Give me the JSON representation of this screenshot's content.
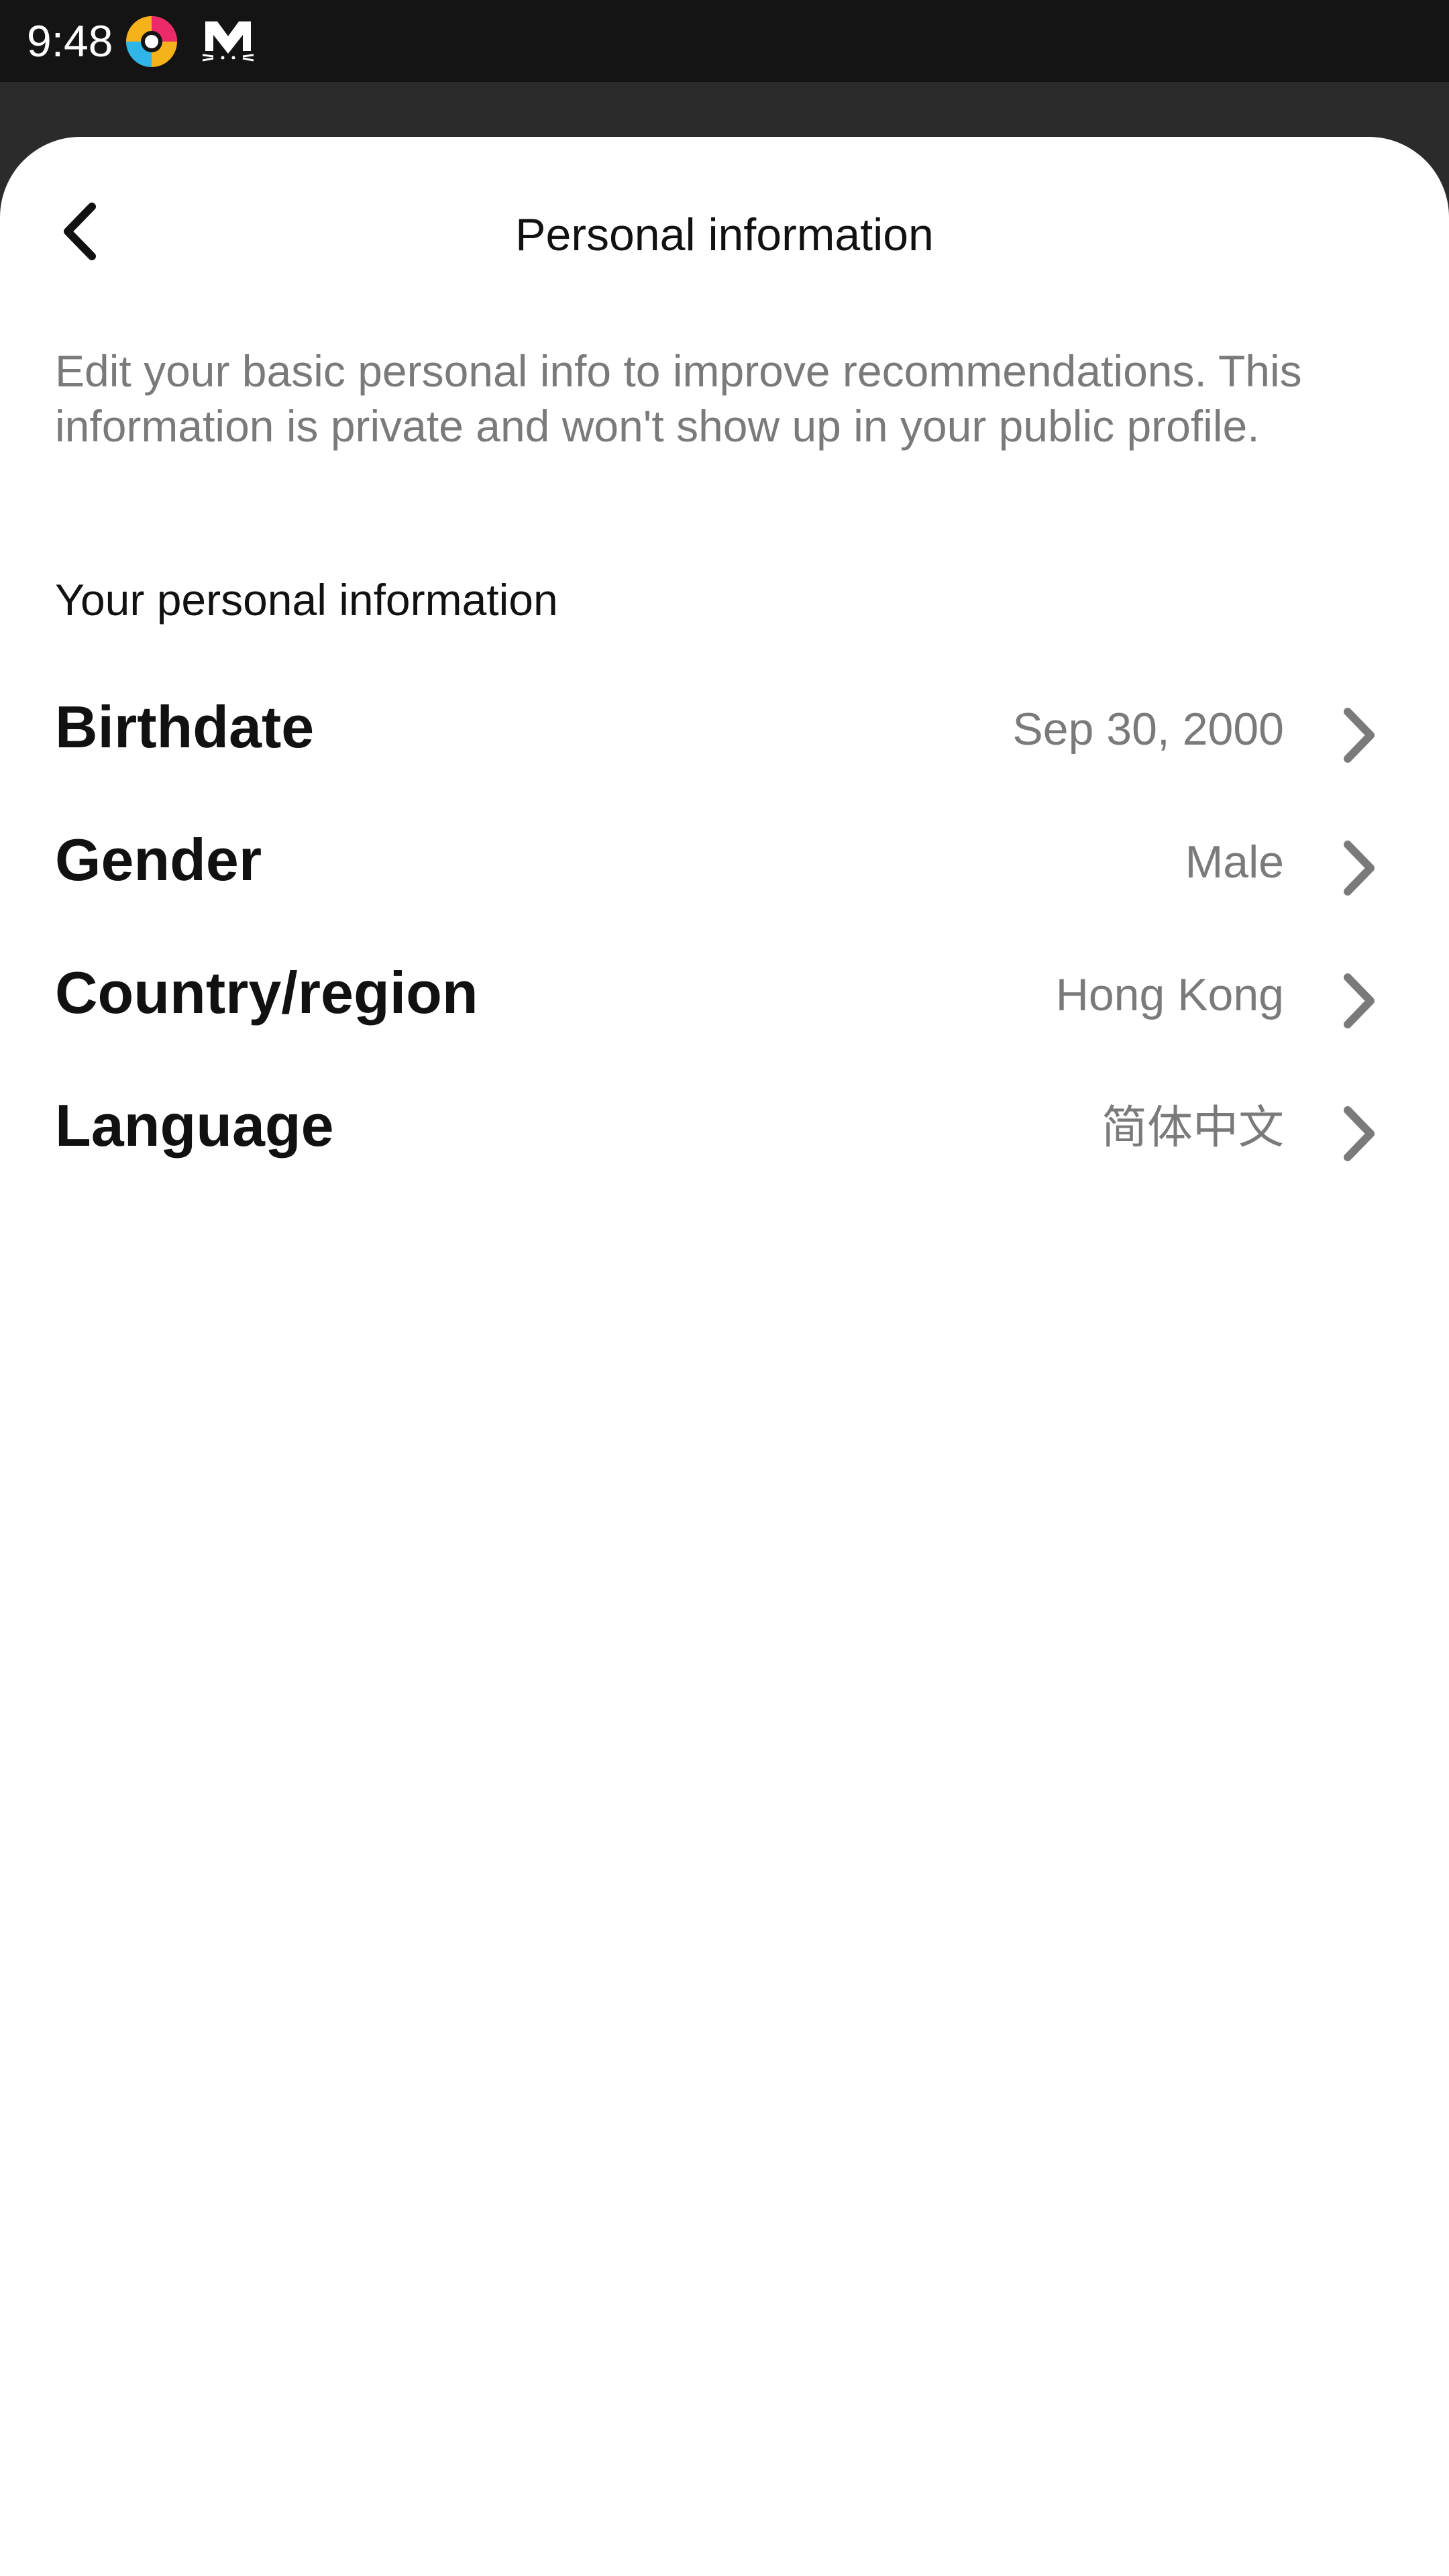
{
  "status_bar": {
    "time": "9:48",
    "icons": [
      "browser-app-icon",
      "mail-cat-icon"
    ]
  },
  "header": {
    "title": "Personal information",
    "back_icon": "chevron-left-icon"
  },
  "description": "Edit your basic personal info to improve recommendations. This information is private and won't show up in your public profile.",
  "section": {
    "title": "Your personal information"
  },
  "items": [
    {
      "label": "Birthdate",
      "value": "Sep 30, 2000"
    },
    {
      "label": "Gender",
      "value": "Male"
    },
    {
      "label": "Country/region",
      "value": "Hong Kong"
    },
    {
      "label": "Language",
      "value": "简体中文"
    }
  ],
  "colors": {
    "status_bar": "#141414",
    "backdrop": "#2b2b2b",
    "sheet": "#ffffff",
    "primary_text": "#111111",
    "secondary_text": "#7a7a7a",
    "chevron": "#7a7a7a"
  }
}
